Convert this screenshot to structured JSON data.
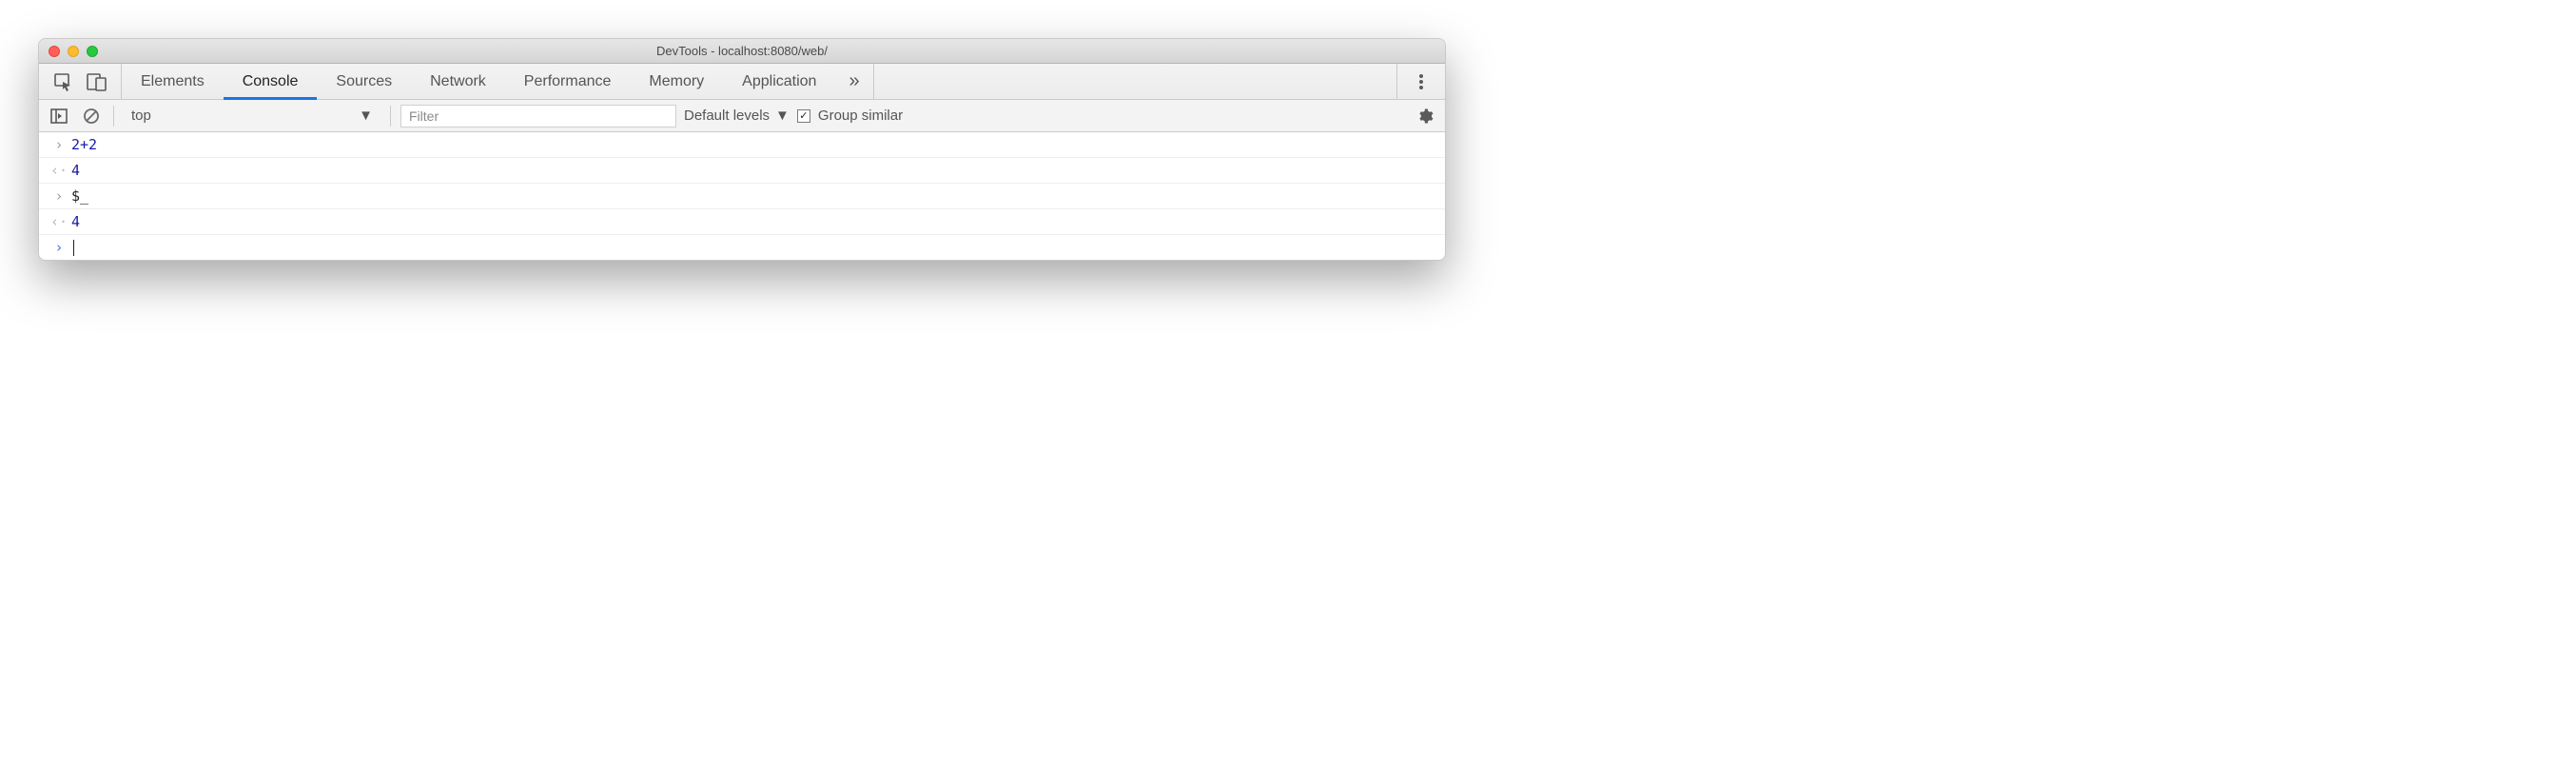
{
  "window": {
    "title": "DevTools - localhost:8080/web/"
  },
  "tabs": {
    "items": [
      {
        "label": "Elements"
      },
      {
        "label": "Console"
      },
      {
        "label": "Sources"
      },
      {
        "label": "Network"
      },
      {
        "label": "Performance"
      },
      {
        "label": "Memory"
      },
      {
        "label": "Application"
      }
    ],
    "active_index": 1,
    "more_glyph": "»"
  },
  "toolbar": {
    "context": "top",
    "filter_placeholder": "Filter",
    "levels_label": "Default levels",
    "group_similar_label": "Group similar",
    "group_similar_checked": true
  },
  "console": {
    "entries": [
      {
        "kind": "input",
        "text": "2+2",
        "color": "blue"
      },
      {
        "kind": "output",
        "text": "4",
        "color": "blue"
      },
      {
        "kind": "input",
        "text": "$_",
        "color": "plain"
      },
      {
        "kind": "output",
        "text": "4",
        "color": "blue"
      }
    ]
  }
}
